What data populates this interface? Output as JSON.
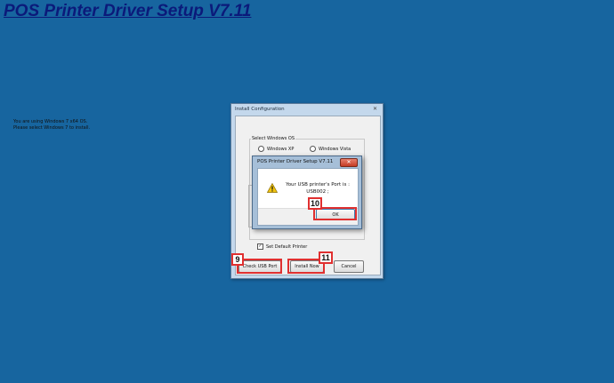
{
  "page": {
    "title": "POS Printer Driver Setup V7.11"
  },
  "main_dialog": {
    "title": "Install Configuration",
    "info_line1": "You are using Windows 7 x64 OS.",
    "info_line2": "Please select Windows 7 to install.",
    "group_label": "Select Windows OS",
    "os_options": [
      "Windows XP",
      "Windows Vista"
    ],
    "set_default_label": "Set Default Printer",
    "check_usb_label": "Check USB Port",
    "install_now_label": "Install Now",
    "cancel_label": "Cancel"
  },
  "message_box": {
    "title": "POS Printer Driver Setup V7.11",
    "line1": "Your USB printer's Port is :",
    "line2": "USB002 ;",
    "ok_label": "OK"
  },
  "callouts": {
    "check_usb_step": "9",
    "ok_step": "10",
    "install_step": "11"
  },
  "colors": {
    "background": "#17659f",
    "highlight": "#e03030",
    "title_text": "#0b1a7a"
  }
}
